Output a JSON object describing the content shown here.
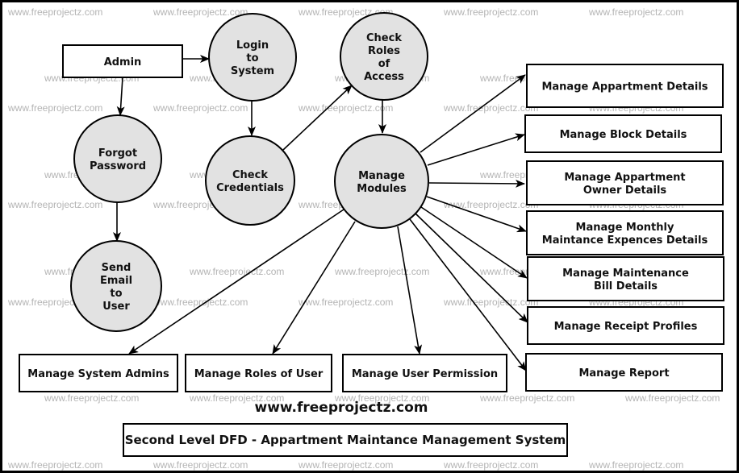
{
  "diagram": {
    "type": "Data Flow Diagram (Level 2)",
    "title": "Second Level DFD - Appartment Maintance Management System",
    "website": "www.freeprojectz.com",
    "watermark": "www.freeprojectz.com",
    "colors": {
      "process_fill": "#e2e2e2",
      "stroke": "#000000",
      "watermark": "#b4b4b4"
    },
    "entities": [
      {
        "id": "admin",
        "lines": [
          "Admin"
        ]
      },
      {
        "id": "appt",
        "lines": [
          "Manage Appartment Details"
        ]
      },
      {
        "id": "block",
        "lines": [
          "Manage Block Details"
        ]
      },
      {
        "id": "owner",
        "lines": [
          "Manage Appartment",
          "Owner Details"
        ]
      },
      {
        "id": "monthly",
        "lines": [
          "Manage Monthly",
          "Maintance Expences Details"
        ]
      },
      {
        "id": "bill",
        "lines": [
          "Manage Maintenance",
          "Bill Details"
        ]
      },
      {
        "id": "receipt",
        "lines": [
          "Manage Receipt Profiles"
        ]
      },
      {
        "id": "report",
        "lines": [
          "Manage Report"
        ]
      },
      {
        "id": "sysadmins",
        "lines": [
          "Manage System Admins"
        ]
      },
      {
        "id": "roles",
        "lines": [
          "Manage Roles of User"
        ]
      },
      {
        "id": "perm",
        "lines": [
          "Manage User Permission"
        ]
      }
    ],
    "processes": [
      {
        "id": "login",
        "lines": [
          "Login",
          "to",
          "System"
        ]
      },
      {
        "id": "checkroles",
        "lines": [
          "Check",
          "Roles",
          "of",
          "Access"
        ]
      },
      {
        "id": "forgot",
        "lines": [
          "Forgot",
          "Password"
        ]
      },
      {
        "id": "checkcred",
        "lines": [
          "Check",
          "Credentials"
        ]
      },
      {
        "id": "modules",
        "lines": [
          "Manage",
          "Modules"
        ]
      },
      {
        "id": "email",
        "lines": [
          "Send",
          "Email",
          "to",
          "User"
        ]
      }
    ],
    "flows": [
      {
        "from": "admin",
        "to": "login"
      },
      {
        "from": "admin",
        "to": "forgot"
      },
      {
        "from": "forgot",
        "to": "email"
      },
      {
        "from": "login",
        "to": "checkcred"
      },
      {
        "from": "checkcred",
        "to": "checkroles"
      },
      {
        "from": "checkroles",
        "to": "modules"
      },
      {
        "from": "modules",
        "to": "appt"
      },
      {
        "from": "modules",
        "to": "block"
      },
      {
        "from": "modules",
        "to": "owner"
      },
      {
        "from": "modules",
        "to": "monthly"
      },
      {
        "from": "modules",
        "to": "bill"
      },
      {
        "from": "modules",
        "to": "receipt"
      },
      {
        "from": "modules",
        "to": "report"
      },
      {
        "from": "modules",
        "to": "sysadmins"
      },
      {
        "from": "modules",
        "to": "roles"
      },
      {
        "from": "modules",
        "to": "perm"
      }
    ]
  }
}
